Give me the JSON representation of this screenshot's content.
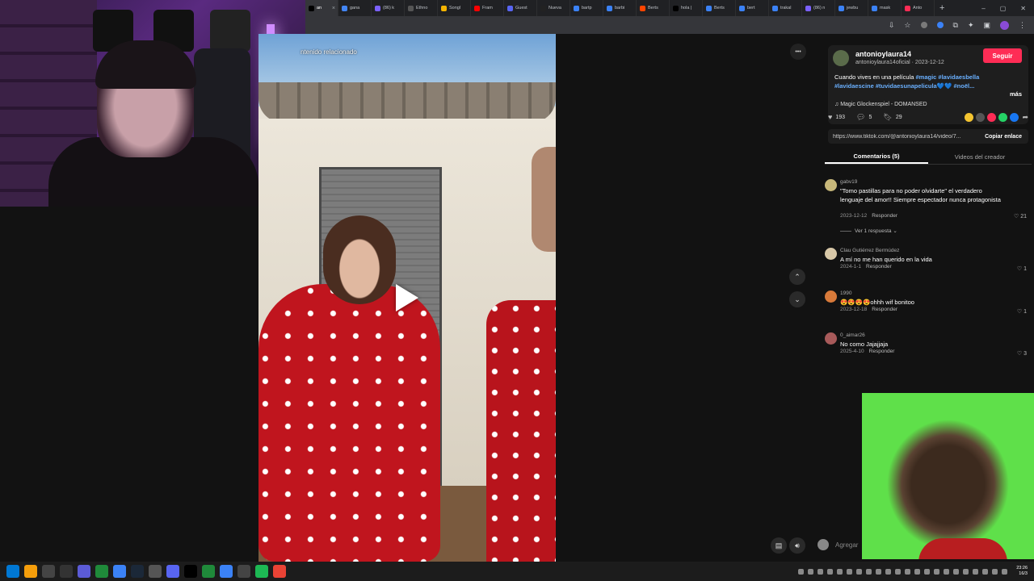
{
  "browser": {
    "tabs": [
      {
        "label": "an",
        "color": "#000000",
        "active": true
      },
      {
        "label": "gana",
        "color": "#4285f4"
      },
      {
        "label": "(86) k",
        "color": "#7b61ff"
      },
      {
        "label": "Ethno",
        "color": "#555555"
      },
      {
        "label": "Songl",
        "color": "#f4b400"
      },
      {
        "label": "Fram",
        "color": "#ff0000"
      },
      {
        "label": "Guest",
        "color": "#5865f2"
      },
      {
        "label": "Nueva",
        "color": "#222222"
      },
      {
        "label": "bartp",
        "color": "#3b82f6"
      },
      {
        "label": "barbi",
        "color": "#3b82f6"
      },
      {
        "label": "Berts",
        "color": "#ff4500"
      },
      {
        "label": "hola |",
        "color": "#000000"
      },
      {
        "label": "Berts",
        "color": "#3b82f6"
      },
      {
        "label": "bert",
        "color": "#3b82f6"
      },
      {
        "label": "trakal",
        "color": "#3b82f6"
      },
      {
        "label": "(86) n",
        "color": "#7b61ff"
      },
      {
        "label": "jewbu",
        "color": "#3b82f6"
      },
      {
        "label": "mask",
        "color": "#3b82f6"
      },
      {
        "label": "Anto",
        "color": "#fe2c55"
      }
    ],
    "new_tab": "+",
    "window_controls": [
      "–",
      "▢",
      "✕"
    ]
  },
  "video": {
    "overlay_label": "ntenido relacionado",
    "more_icon": "•••",
    "nav_up": "⌃",
    "nav_down": "⌄",
    "caption_icon": "caption-icon",
    "volume_icon": "volume-icon"
  },
  "post": {
    "username": "antonioylaura14",
    "subline": "antonioylaura14oficial · 2023-12-12",
    "follow": "Seguir",
    "desc_prefix": "Cuando vives en una película ",
    "hashtags_line1": "#magic #lavidaesbella",
    "hashtags_line2": "#lavidaescine #tuvidaesunapelicula💙💙 #noël...",
    "more": "más",
    "music": "♫  Magic Glockenspiel - DOMANSED",
    "likes": "193",
    "comments": "5",
    "saves": "29",
    "link": "https://www.tiktok.com/@antonioylaura14/video/7...",
    "copy": "Copiar enlace",
    "tab_comments": "Comentarios (5)",
    "tab_creator": "Videos del creador",
    "input_placeholder": "Agregar",
    "share_colors": [
      "#f4c430",
      "#555555",
      "#fe2c55",
      "#25d366",
      "#1877f2"
    ]
  },
  "comments": [
    {
      "user": "gabv19",
      "text": "\"Tomo pastillas para no poder olvidarte\" el verdadero lenguaje del amor!! Siempre espectador nunca protagonista",
      "date": "2023-12-12",
      "reply": "Responder",
      "likes": "21",
      "replies": "Ver 1 respuesta ⌄",
      "color": "#c8b87a"
    },
    {
      "user": "Clau Gutiérrez Bermúdez",
      "text": "A mí no me han querido en la vida",
      "date": "2024-1-1",
      "reply": "Responder",
      "likes": "1",
      "color": "#d8c8a8"
    },
    {
      "user": "1990",
      "text": "😍😍😍😍ohhh wif bonitoo",
      "date": "2023-12-18",
      "reply": "Responder",
      "likes": "1",
      "color": "#d87a3a"
    },
    {
      "user": "0_aimar26",
      "text": "No como Jajajjaja",
      "date": "2025-4-10",
      "reply": "Responder",
      "likes": "3",
      "color": "#a85a5a"
    }
  ],
  "taskbar": {
    "icons": [
      "windows-icon",
      "search-icon",
      "app-icon",
      "app-icon",
      "v-icon",
      "vpn-icon",
      "store-icon",
      "steam-icon",
      "app-icon",
      "discord-icon",
      "tiktok-icon",
      "app-icon",
      "app-icon",
      "app-icon",
      "spotify-icon",
      "chrome-icon"
    ],
    "time": "23:26",
    "date": "16/3"
  }
}
